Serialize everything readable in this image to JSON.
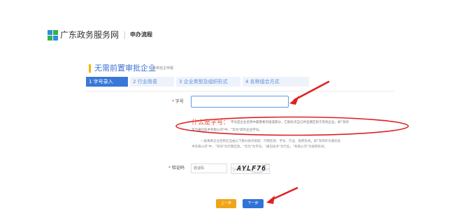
{
  "header": {
    "site_name": "广东政务服务网",
    "section": "申办流程",
    "logo_icon": "guangdong-gov-logo-icon"
  },
  "page": {
    "title": "无需前置审批企业",
    "subtitle": "名称自主申报"
  },
  "steps": [
    {
      "label": "1 字号录入",
      "active": true
    },
    {
      "label": "2 行业用语",
      "active": false
    },
    {
      "label": "3 企业类型及组织形式",
      "active": false
    },
    {
      "label": "4 名称组合方式",
      "active": false
    }
  ],
  "form": {
    "name_label": "字号",
    "name_value": "",
    "explain_title": "什么是字号：",
    "explain_line1": "字号是企业名称中最重要的组成部分，它能标识自己并显著区别于其他企业。如\"深圳",
    "explain_line2": "华为通信技术有限公司\"中，\"华为\"即为企业字号。",
    "struct_line1": "一般来来企业名称应当由以下部分依次组成：行政区划、字号、行业、组织形式。如\"深圳华为通信技",
    "struct_line2": "术有限公司\"中，\"深圳\"为行政区划，\"华为\"为字号，\"通信技术\"为行业，\"有限公司\"为组织形式。",
    "captcha_label": "验证码",
    "captcha_placeholder": "验证码",
    "captcha_text": "AYLF76"
  },
  "buttons": {
    "prev": "上一步",
    "next": "下一步"
  },
  "colors": {
    "accent_blue": "#3a78d8",
    "accent_orange": "#f0a418",
    "annotation_red": "#e02020"
  }
}
